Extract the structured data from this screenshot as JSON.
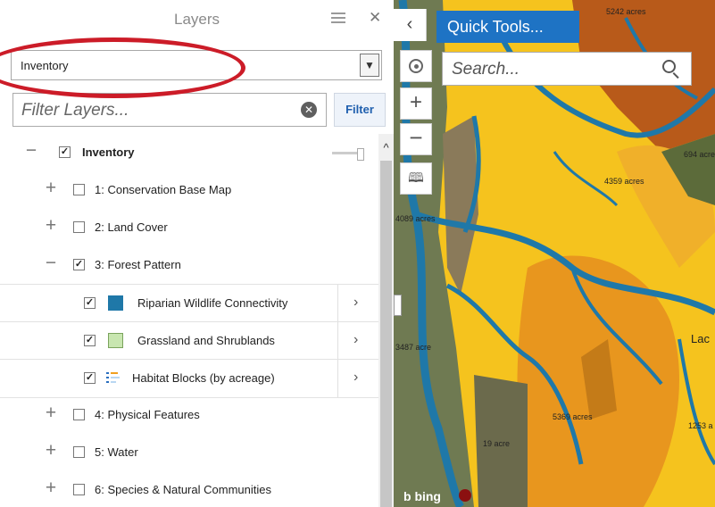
{
  "panel": {
    "title": "Layers",
    "layer_set": "Inventory",
    "filter_placeholder": "Filter Layers...",
    "filter_button": "Filter"
  },
  "tree": {
    "root": "Inventory",
    "groups": [
      {
        "label": "1: Conservation Base Map",
        "expanded": false,
        "checked": false
      },
      {
        "label": "2: Land Cover",
        "expanded": false,
        "checked": false
      },
      {
        "label": "3: Forest Pattern",
        "expanded": true,
        "checked": true
      },
      {
        "label": "4: Physical Features",
        "expanded": false,
        "checked": false
      },
      {
        "label": "5: Water",
        "expanded": false,
        "checked": false
      },
      {
        "label": "6: Species & Natural Communities",
        "expanded": false,
        "checked": false
      }
    ],
    "sublayers": [
      {
        "label": "Riparian Wildlife Connectivity",
        "checked": true,
        "swatch": "#1f78a8"
      },
      {
        "label": "Grassland and Shrublands",
        "checked": true,
        "swatch": "#c8e6b0"
      },
      {
        "label": "Habitat Blocks (by acreage)",
        "checked": true,
        "icon": "habitat-legend-icon"
      }
    ]
  },
  "map": {
    "quick_tools": "Quick Tools...",
    "search_placeholder": "Search...",
    "zoom_in": "+",
    "zoom_out": "−",
    "labels": [
      "5242 acres",
      "694 acre",
      "4359 acres",
      "4089 acres",
      "3487 acre",
      "Lac",
      "5369 acres",
      "1253 a",
      "19 acre"
    ],
    "attribution": "b bing"
  },
  "colors": {
    "accent": "#1e73c4",
    "annotation": "#cc1c28",
    "habitat_yellow": "#f5c31e",
    "habitat_orange": "#e8961e",
    "habitat_rust": "#b85a1a",
    "riparian": "#1f78a8"
  }
}
